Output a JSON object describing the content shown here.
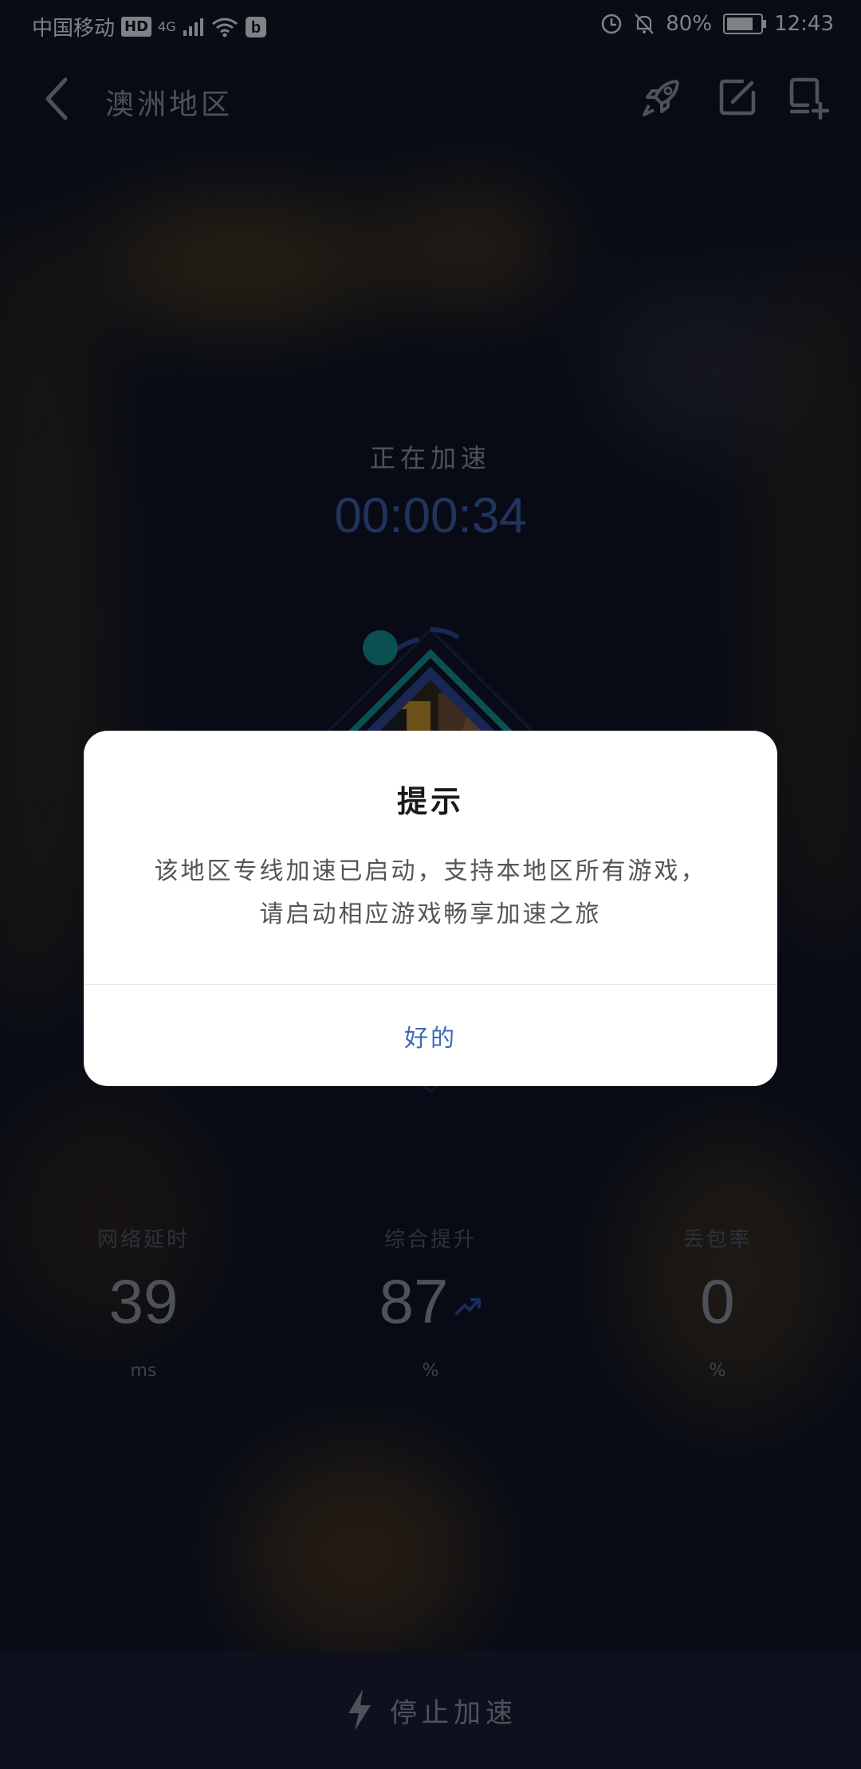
{
  "status_bar": {
    "carrier": "中国移动",
    "hd": "HD",
    "network": "4G",
    "battery": "80%",
    "time": "12:43"
  },
  "header": {
    "title": "澳洲地区"
  },
  "acceleration": {
    "label": "正在加速",
    "timer": "00:00:34"
  },
  "stats": [
    {
      "label": "网络延时",
      "value": "39",
      "unit": "ms"
    },
    {
      "label": "综合提升",
      "value": "87",
      "unit": "%"
    },
    {
      "label": "丢包率",
      "value": "0",
      "unit": "%"
    }
  ],
  "bottom": {
    "stop_label": "停止加速"
  },
  "dialog": {
    "title": "提示",
    "message_line1": "该地区专线加速已启动，支持本地区所有游戏，",
    "message_line2": "请启动相应游戏畅享加速之旅",
    "ok_label": "好的"
  },
  "colors": {
    "accent": "#3d6bb6",
    "timer": "#35589a",
    "ring_teal": "#0d8b86",
    "ring_blue": "#2b3f8f"
  },
  "icons": {
    "back": "chevron-left-icon",
    "rocket": "rocket-icon",
    "edit": "edit-icon",
    "add_window": "add-window-icon",
    "trend": "trend-up-icon",
    "bolt": "lightning-icon"
  }
}
